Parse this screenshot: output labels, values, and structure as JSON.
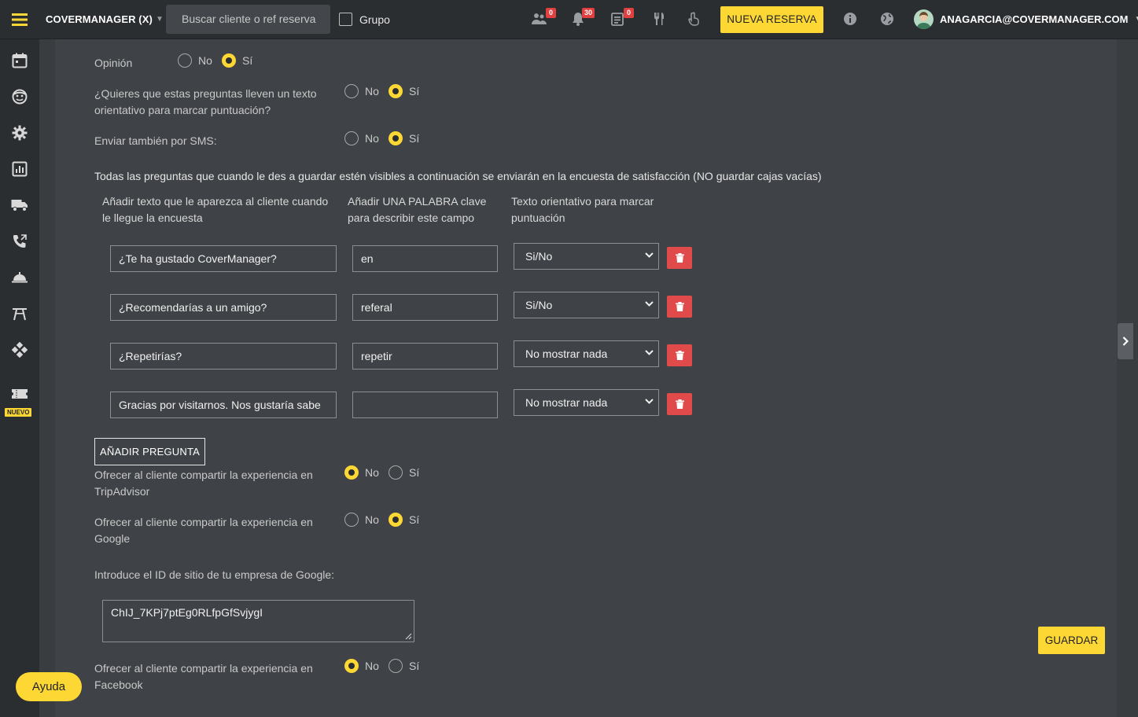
{
  "topbar": {
    "brand": "COVERMANAGER (X)",
    "search_placeholder": "Buscar cliente o ref reserva",
    "grupo_label": "Grupo",
    "badges": {
      "people": "0",
      "bell": "30",
      "list": "0"
    },
    "new_reservation": "NUEVA RESERVA",
    "user_email": "ANAGARCIA@COVERMANAGER.COM"
  },
  "sidebar": {
    "nuevo_tag": "NUEVO"
  },
  "form": {
    "opinion_label": "Opinión",
    "orientative_label": "¿Quieres que estas preguntas lleven un texto orientativo para marcar puntuación?",
    "sms_label": "Enviar también por SMS:",
    "no": "No",
    "si": "Sí",
    "info_text": "Todas las preguntas que cuando le des a guardar estén visibles a continuación se enviarán en la encuesta de satisfacción (NO guardar cajas vacías)",
    "col1": "Añadir texto que le aparezca al cliente cuando le llegue la encuesta",
    "col2": "Añadir UNA PALABRA clave para describir este campo",
    "col3": "Texto orientativo para marcar puntuación",
    "questions": [
      {
        "text": "¿Te ha gustado CoverManager?",
        "keyword": "en",
        "option": "Si/No"
      },
      {
        "text": "¿Recomendarías a un amigo?",
        "keyword": "referal",
        "option": "Si/No"
      },
      {
        "text": "¿Repetirías?",
        "keyword": "repetir",
        "option": "No mostrar nada"
      },
      {
        "text": "Gracias por visitarnos. Nos gustaría sabe",
        "keyword": "",
        "option": "No mostrar nada"
      }
    ],
    "add_question": "AÑADIR PREGUNTA",
    "tripadvisor_label": "Ofrecer al cliente compartir la experiencia en TripAdvisor",
    "google_label": "Ofrecer al cliente compartir la experiencia en Google",
    "google_id_label": "Introduce el ID de sitio de tu empresa de Google:",
    "google_id_value": "ChIJ_7KPj7ptEg0RLfpGfSvjygI",
    "facebook_label": "Ofrecer al cliente compartir la experiencia en Facebook",
    "save": "GUARDAR"
  },
  "help": "Ayuda",
  "colors": {
    "accent": "#fdd835",
    "danger": "#e04a4a",
    "topbar": "#2b2e31",
    "panel": "#3f4246"
  }
}
